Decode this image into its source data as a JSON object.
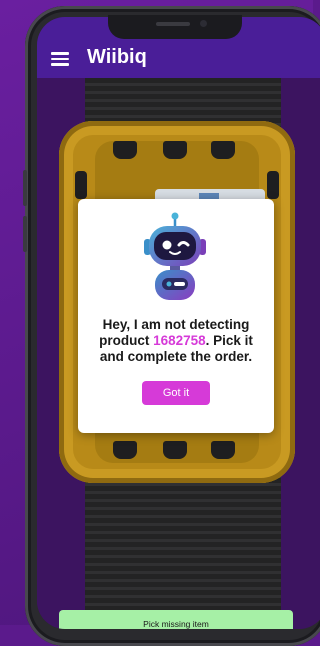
{
  "app": {
    "title": "Wiibiq"
  },
  "dialog": {
    "message_prefix": "Hey, I am not detecting product ",
    "product_id": "1682758",
    "message_suffix": ". Pick it and complete the order.",
    "confirm_label": "Got it"
  },
  "actions": {
    "pick_missing_label": "Pick missing item"
  },
  "colors": {
    "app_bar": "#4a1e98",
    "accent": "#d63ad8",
    "action_button": "#a6f0a6",
    "tote": "#b88a18"
  },
  "icons": {
    "menu": "hamburger-menu-icon",
    "mascot": "robot-mascot-icon"
  }
}
